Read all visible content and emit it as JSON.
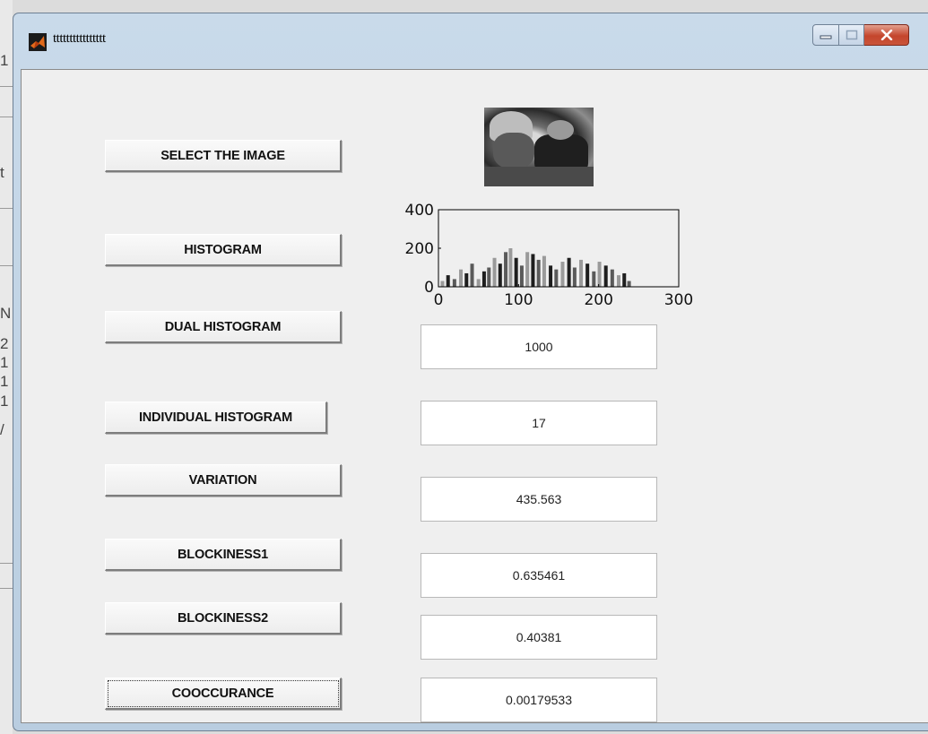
{
  "window": {
    "title": "tttttttttttttttt"
  },
  "background_fragments": [
    "1",
    "t",
    "N",
    "2",
    "1",
    "1",
    "1",
    "/"
  ],
  "buttons": {
    "select_image": "SELECT THE IMAGE",
    "histogram": "HISTOGRAM",
    "dual_histogram": "DUAL HISTOGRAM",
    "individual_histogram": "INDIVIDUAL HISTOGRAM",
    "variation": "VARIATION",
    "blockiness1": "BLOCKINESS1",
    "blockiness2": "BLOCKINESS2",
    "cooccurance": "COOCCURANCE"
  },
  "outputs": {
    "dual_histogram": "1000",
    "individual_histogram": "17",
    "variation": "435.563",
    "blockiness1": "0.635461",
    "blockiness2": "0.40381",
    "cooccurance": "0.00179533"
  },
  "chart_data": {
    "type": "bar",
    "title": "",
    "xlabel": "",
    "ylabel": "",
    "xlim": [
      0,
      300
    ],
    "ylim": [
      0,
      400
    ],
    "xticks": [
      "0",
      "100",
      "200",
      "300"
    ],
    "yticks": [
      "0",
      "200",
      "400"
    ],
    "x": [
      5,
      12,
      20,
      28,
      35,
      42,
      50,
      57,
      63,
      70,
      77,
      84,
      90,
      97,
      104,
      111,
      118,
      125,
      132,
      140,
      147,
      155,
      163,
      170,
      178,
      186,
      194,
      201,
      209,
      217,
      225,
      232,
      238
    ],
    "values": [
      30,
      60,
      40,
      90,
      70,
      120,
      40,
      80,
      100,
      150,
      120,
      180,
      200,
      150,
      110,
      180,
      170,
      140,
      160,
      110,
      90,
      130,
      150,
      100,
      140,
      120,
      80,
      130,
      110,
      90,
      60,
      70,
      30
    ],
    "colors": [
      "#9a9a9a",
      "#1e1e1e",
      "#5a5a5a"
    ]
  }
}
